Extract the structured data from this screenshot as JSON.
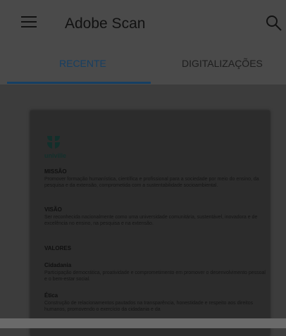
{
  "app": {
    "title": "Adobe Scan"
  },
  "tabs": [
    {
      "label": "RECENTE",
      "active": true
    },
    {
      "label": "DIGITALIZAÇÕES",
      "active": false
    }
  ],
  "colors": {
    "accent": "#163f63",
    "appbar": "#4a4a4a",
    "background": "#3e3e3e"
  },
  "icons": {
    "menu": "hamburger-menu-icon",
    "search": "search-icon"
  },
  "document": {
    "logo_text": "univille",
    "sections": [
      {
        "title": "MISSÃO",
        "text": "Promover formação humanística, científica e profissional para a sociedade por meio do ensino, da pesquisa e da extensão, comprometida com a sustentabilidade socioambiental."
      },
      {
        "title": "VISÃO",
        "text": "Ser reconhecida nacionalmente como uma universidade comunitária, sustentável, inovadora e de excelência no ensino, na pesquisa e na extensão."
      },
      {
        "title": "VALORES",
        "text": ""
      },
      {
        "title": "Cidadania",
        "text": "Participação democrática, proatividade e comprometimento em promover o desenvolvimento pessoal e o bem-estar social."
      },
      {
        "title": "Ética",
        "text": "Construção de relacionamentos pautados na transparência, honestidade e respeito aos direitos humanos, promovendo o exercício da cidadania e da"
      }
    ]
  }
}
